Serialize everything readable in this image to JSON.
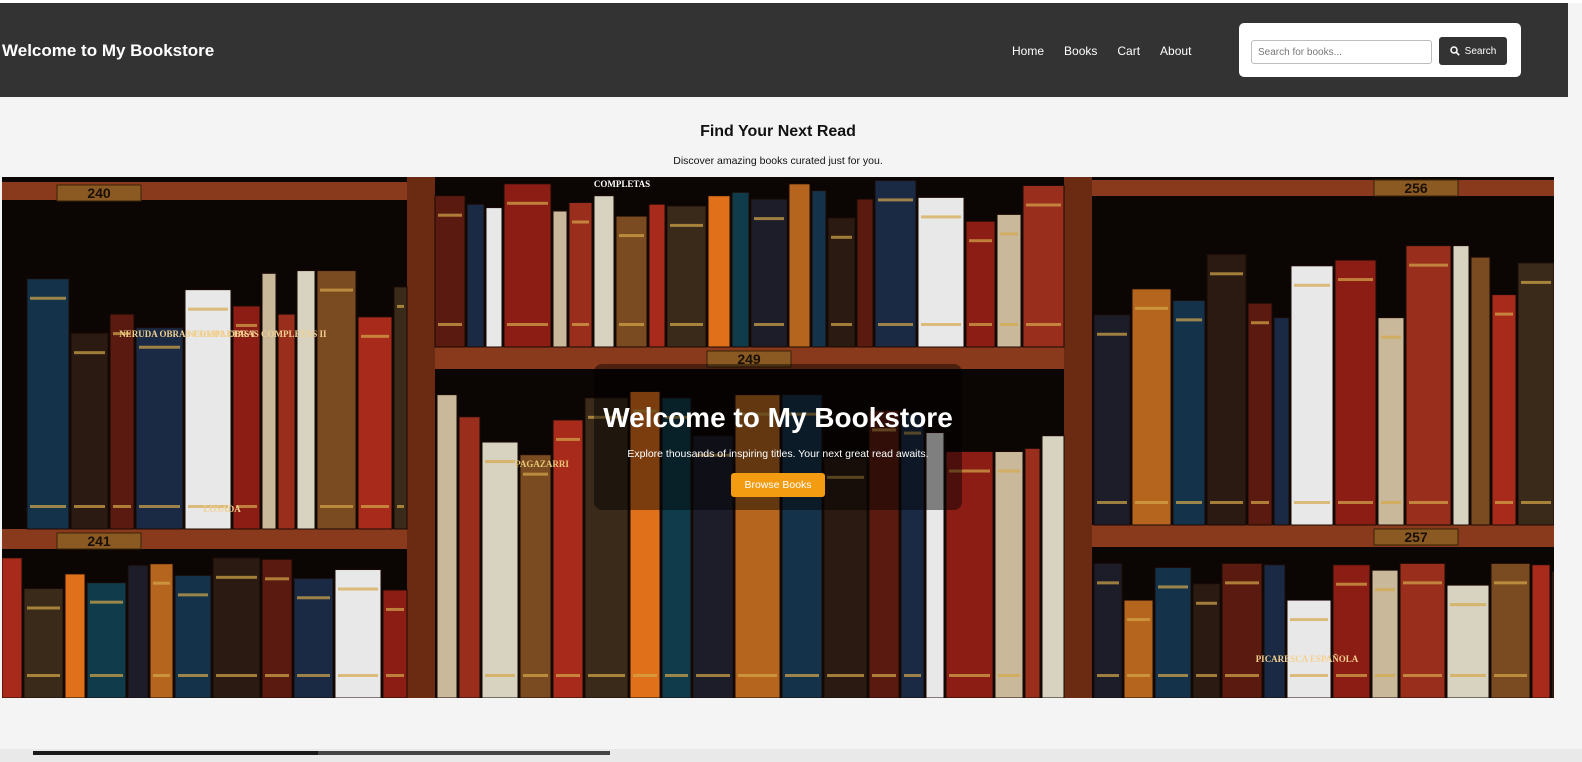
{
  "header": {
    "title": "Welcome to My Bookstore",
    "nav": [
      "Home",
      "Books",
      "Cart",
      "About"
    ],
    "search_placeholder": "Search for books...",
    "search_button": "Search",
    "search_icon": "search-icon"
  },
  "intro": {
    "title": "Find Your Next Read",
    "subtitle": "Discover amazing books curated just for you."
  },
  "hero": {
    "title": "Welcome to My Bookstore",
    "subtitle": "Explore thousands of inspiring titles. Your next great read awaits.",
    "cta": "Browse Books",
    "shelf_labels": [
      "240",
      "241",
      "249",
      "256",
      "257"
    ],
    "spine_texts": [
      "NERUDA OBRAS COMPLETAS I",
      "NERUDA OBRAS COMPLETAS II",
      "LOSADA",
      "COMPLETAS",
      "PAGAZARRI",
      "PICARESCA ESPAÑOLA"
    ]
  },
  "colors": {
    "header_bg": "#333333",
    "cta_orange": "#f39c12",
    "page_bg": "#f4f4f4"
  }
}
